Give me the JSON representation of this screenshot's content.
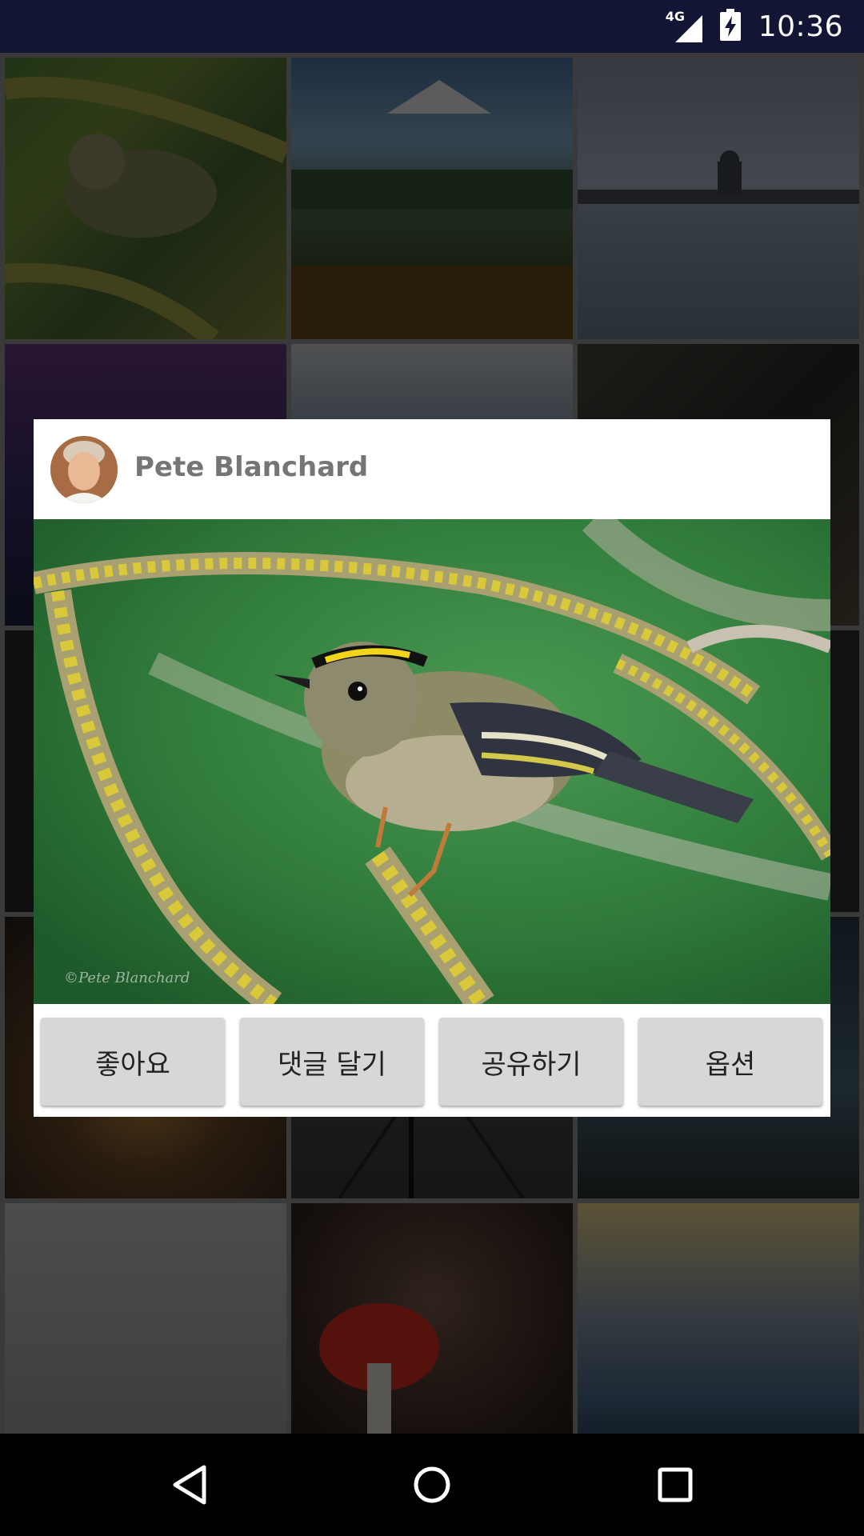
{
  "status_bar": {
    "time": "10:36",
    "network_label": "4G",
    "icons": [
      "signal-icon",
      "battery-charging-icon"
    ]
  },
  "gallery": {
    "tiles": [
      "bird-thumbnail",
      "mountain-lake-thumbnail",
      "city-waterfront-thumbnail",
      "purple-mountain-thumbnail",
      "forest-hills-thumbnail",
      "interior-room-thumbnail",
      "dark-tile-thumbnail",
      "dark-tile-thumbnail",
      "dark-tile-thumbnail",
      "sunset-thumbnail",
      "boardwalk-thumbnail",
      "coast-thumbnail",
      "frosted-grass-thumbnail",
      "mushroom-thumbnail",
      "glacier-lagoon-thumbnail"
    ]
  },
  "dialog": {
    "author_name": "Pete Blanchard",
    "photo_watermark": "©Pete Blanchard",
    "actions": {
      "like": "좋아요",
      "comment": "댓글 달기",
      "share": "공유하기",
      "options": "옵션"
    }
  },
  "navigation": {
    "icons": [
      "back-icon",
      "home-icon",
      "recents-icon"
    ]
  },
  "colors": {
    "status_bar": "#121634",
    "dialog_background": "#ffffff",
    "button_background": "#d6d7d7",
    "author_text": "#757575"
  }
}
